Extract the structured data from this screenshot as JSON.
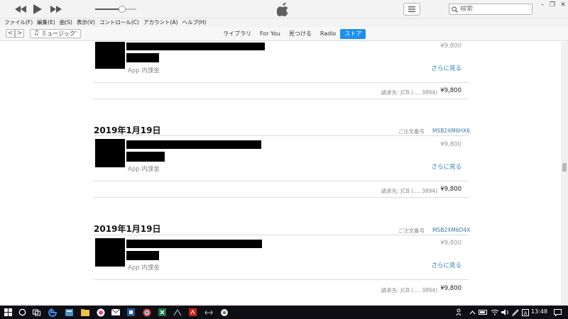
{
  "search": {
    "placeholder": "検索"
  },
  "menu": [
    "ファイル(F)",
    "編集(E)",
    "曲(S)",
    "表示(V)",
    "コントロール(C)",
    "アカウント(A)",
    "ヘルプ(H)"
  ],
  "nav": {
    "back": "<",
    "forward": ">",
    "media_select": "ミュージック",
    "tabs": [
      "ライブラリ",
      "For You",
      "見つける",
      "Radio",
      "ストア"
    ],
    "active_tab": "ストア"
  },
  "window_controls": {
    "minimize": "–",
    "maximize": "❐",
    "close": "✕"
  },
  "orders": [
    {
      "date": "",
      "order_label": "",
      "order_number": "",
      "item_type": "App 内課金",
      "price": "¥9,800",
      "see_more": "さらに見る",
      "billing": "請求先: JCB (.... 3894)",
      "total": "¥9,800"
    },
    {
      "date": "2019年1月19日",
      "order_label": "ご注文番号",
      "order_number": "MSB2XM6HX6",
      "item_type": "App 内課金",
      "price": "¥9,800",
      "see_more": "さらに見る",
      "billing": "請求先: JCB (.... 3894)",
      "total": "¥9,800"
    },
    {
      "date": "2019年1月19日",
      "order_label": "ご注文番号",
      "order_number": "MSB2XM6D4X",
      "item_type": "App 内課金",
      "price": "¥9,800",
      "see_more": "さらに見る",
      "billing": "請求先: JCB (.... 3894)",
      "total": "¥9,800"
    }
  ],
  "volume_level": 0.65,
  "taskbar": {
    "clock": "13:48"
  },
  "colors": {
    "accent": "#1d8ff2",
    "link": "#2b7fb0",
    "taskbar": "#0e0e14"
  }
}
